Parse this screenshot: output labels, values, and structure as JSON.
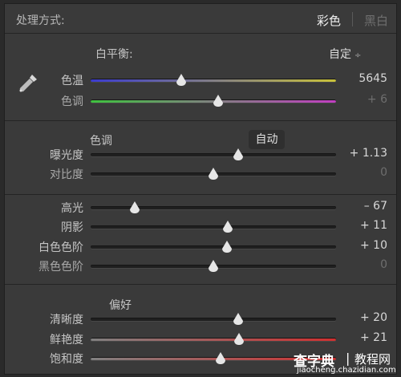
{
  "header": {
    "title": "处理方式:",
    "mode_color": "彩色",
    "mode_bw": "黑白"
  },
  "white_balance": {
    "label": "白平衡:",
    "preset": "自定",
    "preset_arrow": "÷",
    "sliders": [
      {
        "label": "色温",
        "value": "5645",
        "position": 0.37,
        "active": true
      },
      {
        "label": "色调",
        "value": "+ 6",
        "position": 0.52,
        "active": false
      }
    ]
  },
  "tone": {
    "label": "色调",
    "auto_label": "自动",
    "sliders": [
      {
        "label": "曝光度",
        "value": "+ 1.13",
        "position": 0.6,
        "active": true
      },
      {
        "label": "对比度",
        "value": "0",
        "position": 0.5,
        "active": false
      }
    ]
  },
  "tone2": {
    "sliders": [
      {
        "label": "高光",
        "value": "– 67",
        "position": 0.18,
        "active": true
      },
      {
        "label": "阴影",
        "value": "+ 11",
        "position": 0.56,
        "active": true
      },
      {
        "label": "白色色阶",
        "value": "+ 10",
        "position": 0.555,
        "active": true
      },
      {
        "label": "黑色色阶",
        "value": "0",
        "position": 0.5,
        "active": false
      }
    ]
  },
  "presence": {
    "label": "偏好",
    "sliders": [
      {
        "label": "清晰度",
        "value": "+ 20",
        "position": 0.6,
        "active": true
      },
      {
        "label": "鲜艳度",
        "value": "+ 21",
        "position": 0.605,
        "active": true
      },
      {
        "label": "饱和度",
        "value": "",
        "position": 0.53,
        "active": true
      }
    ]
  },
  "watermark": {
    "brand": "查字典",
    "pipe": "|",
    "lesson": "教程网",
    "url": "jiaocheng.chazidian.com"
  },
  "colors": {
    "panel": "#3a3a3a",
    "temp_gradient": [
      "#3b3bd0",
      "#c9c23a"
    ],
    "tint_gradient": [
      "#3fc23f",
      "#c23fc2"
    ],
    "vibrance_gradient": [
      "#808080",
      "#d03030"
    ],
    "saturation_gradient": [
      "#808080",
      "#d03030"
    ]
  }
}
